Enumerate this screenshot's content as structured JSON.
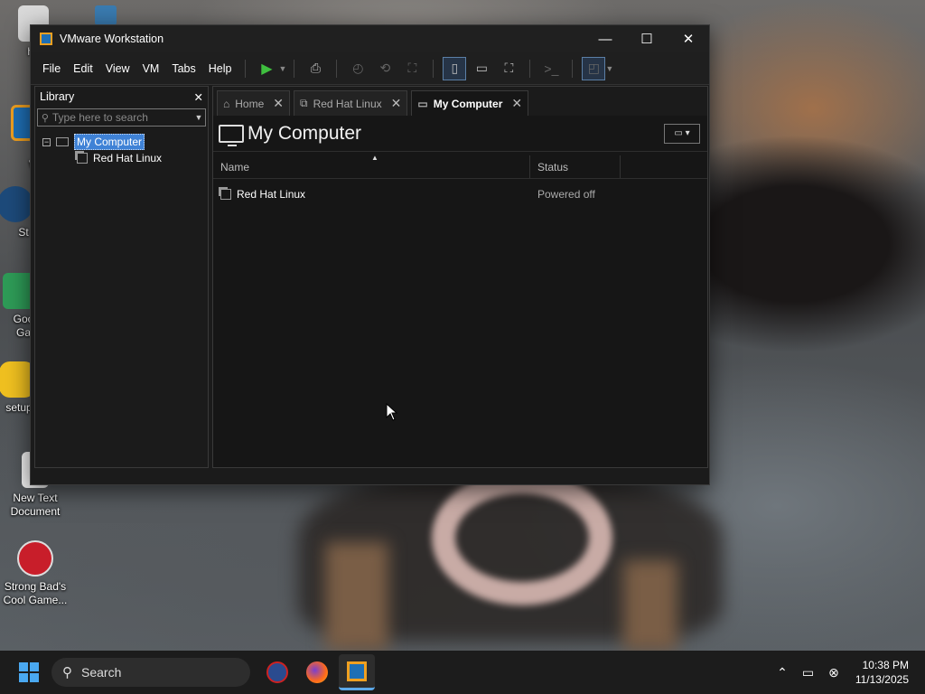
{
  "desktop": {
    "icons": [
      {
        "label": "ha",
        "color": "#d9d9d9"
      },
      {
        "label": "VM Work",
        "color": "#1e6fb5"
      },
      {
        "label": "St",
        "color": "#1d4a7a"
      },
      {
        "label": "Goo Ga",
        "color": "#2e9b57"
      },
      {
        "label": "setup",
        "color": "#f0c020"
      },
      {
        "label": "New Text Document",
        "color": "#f4f4f4"
      },
      {
        "label": "Strong Bad's Cool Game...",
        "color": "#c81e2a"
      }
    ]
  },
  "window": {
    "title": "VMware Workstation",
    "controls": {
      "minimize": "—",
      "maximize": "☐",
      "close": "✕"
    },
    "menu": [
      "File",
      "Edit",
      "View",
      "VM",
      "Tabs",
      "Help"
    ],
    "library": {
      "title": "Library",
      "close": "✕",
      "search_placeholder": "Type here to search",
      "tree": {
        "root": "My Computer",
        "children": [
          "Red Hat Linux"
        ]
      }
    },
    "tabs": [
      {
        "label": "Home",
        "icon": "home-icon",
        "active": false
      },
      {
        "label": "Red Hat Linux",
        "icon": "vm-icon",
        "active": false
      },
      {
        "label": "My Computer",
        "icon": "monitor-icon",
        "active": true
      }
    ],
    "page": {
      "title": "My Computer",
      "columns": [
        "Name",
        "Status"
      ],
      "rows": [
        {
          "name": "Red Hat Linux",
          "status": "Powered off"
        }
      ]
    }
  },
  "taskbar": {
    "search_label": "Search",
    "time": "10:38 PM",
    "date": "11/13/2025",
    "accent": "#5ca8e8"
  }
}
